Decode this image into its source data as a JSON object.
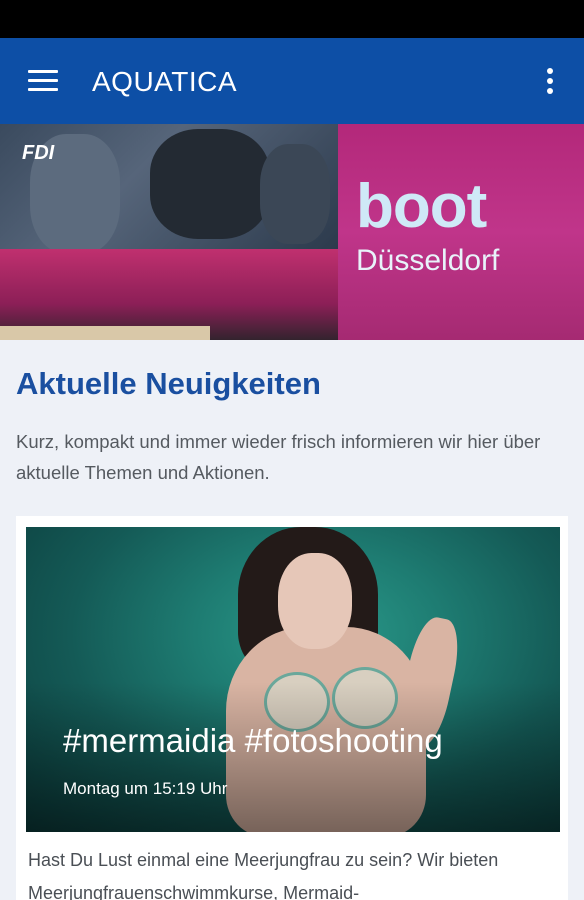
{
  "app_bar": {
    "title": "AQUATICA",
    "menu_icon": "hamburger-menu-icon",
    "overflow_icon": "more-vert-icon",
    "background": "#0d4fa6"
  },
  "hero": {
    "logo_word": "boot",
    "logo_city": "Düsseldorf",
    "screen_brand": "FDI"
  },
  "section": {
    "title": "Aktuelle Neuigkeiten",
    "intro": "Kurz, kompakt und immer wieder frisch informieren wir hier über aktuelle Themen und Aktionen."
  },
  "news": [
    {
      "title": "#mermaidia #fotoshooting",
      "date": "Montag um 15:19 Uhr",
      "excerpt": "Hast Du Lust einmal eine Meerjungfrau zu sein? Wir bieten Meerjungfrauenschwimmkurse, Mermaid-"
    }
  ],
  "colors": {
    "accent": "#1a4fa0",
    "page_background": "#eef1f7"
  }
}
